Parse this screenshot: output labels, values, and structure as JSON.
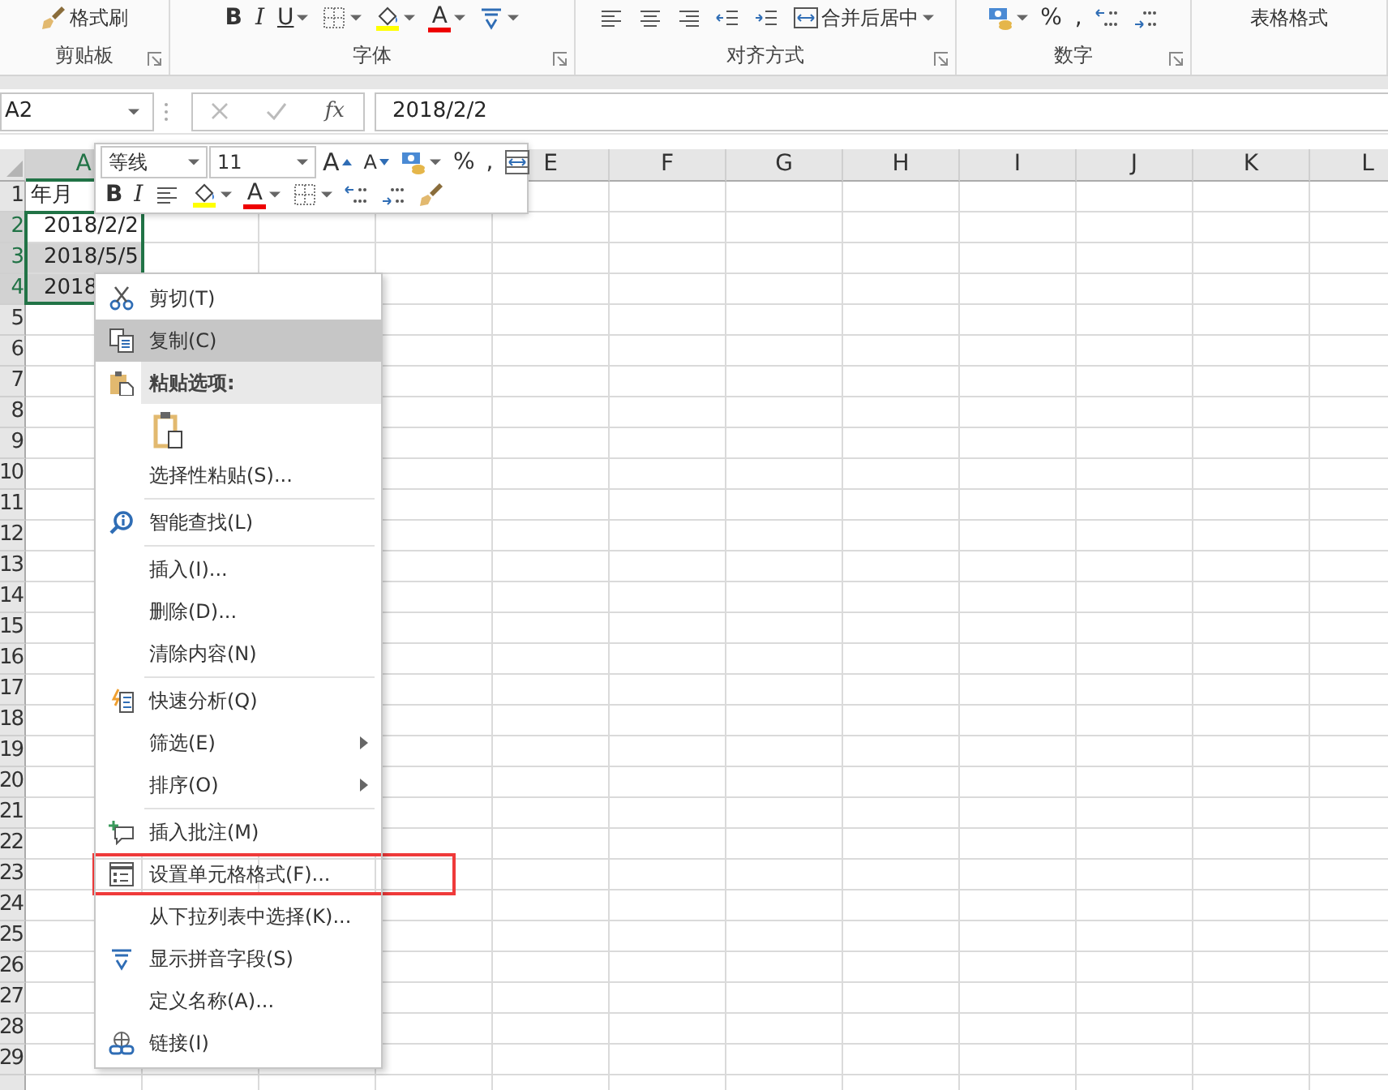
{
  "ribbon": {
    "groups": [
      {
        "label": "剪贴板",
        "launcher": true,
        "items": [
          {
            "kind": "icon-text",
            "text": "格式刷"
          }
        ]
      },
      {
        "label": "字体",
        "launcher": true,
        "items": [
          {
            "kind": "bold",
            "text": "B"
          },
          {
            "kind": "italic",
            "text": "I"
          },
          {
            "kind": "underline",
            "text": "U",
            "dropdown": true
          },
          {
            "kind": "icon",
            "dropdown": true
          },
          {
            "kind": "icon",
            "dropdown": true
          },
          {
            "kind": "font-color",
            "text": "A",
            "dropdown": true
          },
          {
            "kind": "icon",
            "dropdown": true
          }
        ]
      },
      {
        "label": "对齐方式",
        "launcher": true,
        "items": [
          {
            "kind": "icon"
          },
          {
            "kind": "icon"
          },
          {
            "kind": "icon"
          },
          {
            "kind": "icon"
          },
          {
            "kind": "icon"
          },
          {
            "kind": "icon-text",
            "text": "合并后居中",
            "dropdown": true
          }
        ]
      },
      {
        "label": "数字",
        "launcher": true,
        "items": [
          {
            "kind": "icon",
            "dropdown": true
          },
          {
            "kind": "text",
            "text": "%"
          },
          {
            "kind": "text",
            "text": ","
          },
          {
            "kind": "icon"
          },
          {
            "kind": "icon"
          }
        ]
      },
      {
        "items": [
          {
            "kind": "text",
            "text": "表格格式"
          }
        ]
      }
    ]
  },
  "formula_bar": {
    "name_box": "A2",
    "function_label": "fx",
    "formula": "2018/2/2"
  },
  "mini_toolbar": {
    "top_row": [
      {
        "kind": "select",
        "text": "等线"
      },
      {
        "kind": "select",
        "text": "11"
      },
      {
        "kind": "grow",
        "text": "A"
      },
      {
        "kind": "shrink",
        "text": "A"
      },
      {
        "kind": "icon",
        "dropdown": true
      },
      {
        "kind": "text",
        "text": "%"
      },
      {
        "kind": "text",
        "text": ","
      },
      {
        "kind": "icon"
      }
    ],
    "bottom_row": [
      {
        "kind": "bold",
        "text": "B"
      },
      {
        "kind": "italic",
        "text": "I"
      },
      {
        "kind": "icon"
      },
      {
        "kind": "icon",
        "dropdown": true
      },
      {
        "kind": "font-color",
        "text": "A",
        "dropdown": true
      },
      {
        "kind": "icon",
        "dropdown": true
      },
      {
        "kind": "icon"
      },
      {
        "kind": "icon"
      },
      {
        "kind": "icon"
      }
    ]
  },
  "sheet": {
    "columns": [
      {
        "label": "A",
        "selected": true
      },
      {
        "label": "E",
        "selected": false
      },
      {
        "label": "F",
        "selected": false
      },
      {
        "label": "G",
        "selected": false
      },
      {
        "label": "H",
        "selected": false
      },
      {
        "label": "I",
        "selected": false
      },
      {
        "label": "J",
        "selected": false
      },
      {
        "label": "K",
        "selected": false
      },
      {
        "label": "L",
        "selected": false
      }
    ],
    "rows": [
      {
        "label": "1",
        "selected": false
      },
      {
        "label": "2",
        "selected": true
      },
      {
        "label": "3",
        "selected": true
      },
      {
        "label": "4",
        "selected": true
      },
      {
        "label": "5",
        "selected": false
      },
      {
        "label": "6",
        "selected": false
      },
      {
        "label": "7",
        "selected": false
      },
      {
        "label": "8",
        "selected": false
      },
      {
        "label": "9",
        "selected": false
      },
      {
        "label": "10",
        "selected": false
      },
      {
        "label": "11",
        "selected": false
      },
      {
        "label": "12",
        "selected": false
      },
      {
        "label": "13",
        "selected": false
      },
      {
        "label": "14",
        "selected": false
      },
      {
        "label": "15",
        "selected": false
      },
      {
        "label": "16",
        "selected": false
      },
      {
        "label": "17",
        "selected": false
      },
      {
        "label": "18",
        "selected": false
      },
      {
        "label": "19",
        "selected": false
      },
      {
        "label": "20",
        "selected": false
      },
      {
        "label": "21",
        "selected": false
      },
      {
        "label": "22",
        "selected": false
      },
      {
        "label": "23",
        "selected": false
      },
      {
        "label": "24",
        "selected": false
      },
      {
        "label": "25",
        "selected": false
      },
      {
        "label": "26",
        "selected": false
      },
      {
        "label": "27",
        "selected": false
      },
      {
        "label": "28",
        "selected": false
      },
      {
        "label": "29",
        "selected": false
      }
    ],
    "cells": [
      {
        "text": "年月",
        "kind": "text",
        "selected": false
      },
      {
        "text": "2018/2/2",
        "kind": "date",
        "selected": true
      },
      {
        "text": "2018/5/5",
        "kind": "date",
        "selected": true
      },
      {
        "text": "2018",
        "kind": "date",
        "selected": true
      }
    ]
  },
  "context_menu": {
    "items": [
      {
        "kind": "item",
        "label": "剪切(T)",
        "selected": false
      },
      {
        "kind": "item",
        "label": "复制(C)",
        "selected": true
      },
      {
        "kind": "header",
        "label": "粘贴选项:"
      },
      {
        "kind": "paste-options"
      },
      {
        "kind": "item",
        "label": "选择性粘贴(S)...",
        "selected": false
      },
      {
        "kind": "item",
        "label": "智能查找(L)",
        "selected": false,
        "divider_before": true
      },
      {
        "kind": "item",
        "label": "插入(I)...",
        "selected": false,
        "divider_before": true
      },
      {
        "kind": "item",
        "label": "删除(D)...",
        "selected": false
      },
      {
        "kind": "item",
        "label": "清除内容(N)",
        "selected": false
      },
      {
        "kind": "item",
        "label": "快速分析(Q)",
        "selected": false,
        "divider_before": true
      },
      {
        "kind": "item",
        "label": "筛选(E)",
        "selected": false,
        "submenu": true
      },
      {
        "kind": "item",
        "label": "排序(O)",
        "selected": false,
        "submenu": true
      },
      {
        "kind": "item",
        "label": "插入批注(M)",
        "selected": false,
        "divider_before": true
      },
      {
        "kind": "item",
        "label": "设置单元格格式(F)...",
        "selected": false,
        "annotated": true
      },
      {
        "kind": "item",
        "label": "从下拉列表中选择(K)...",
        "selected": false
      },
      {
        "kind": "item",
        "label": "显示拼音字段(S)",
        "selected": false
      },
      {
        "kind": "item",
        "label": "定义名称(A)...",
        "selected": false
      },
      {
        "kind": "item",
        "label": "链接(I)",
        "selected": false
      }
    ]
  }
}
